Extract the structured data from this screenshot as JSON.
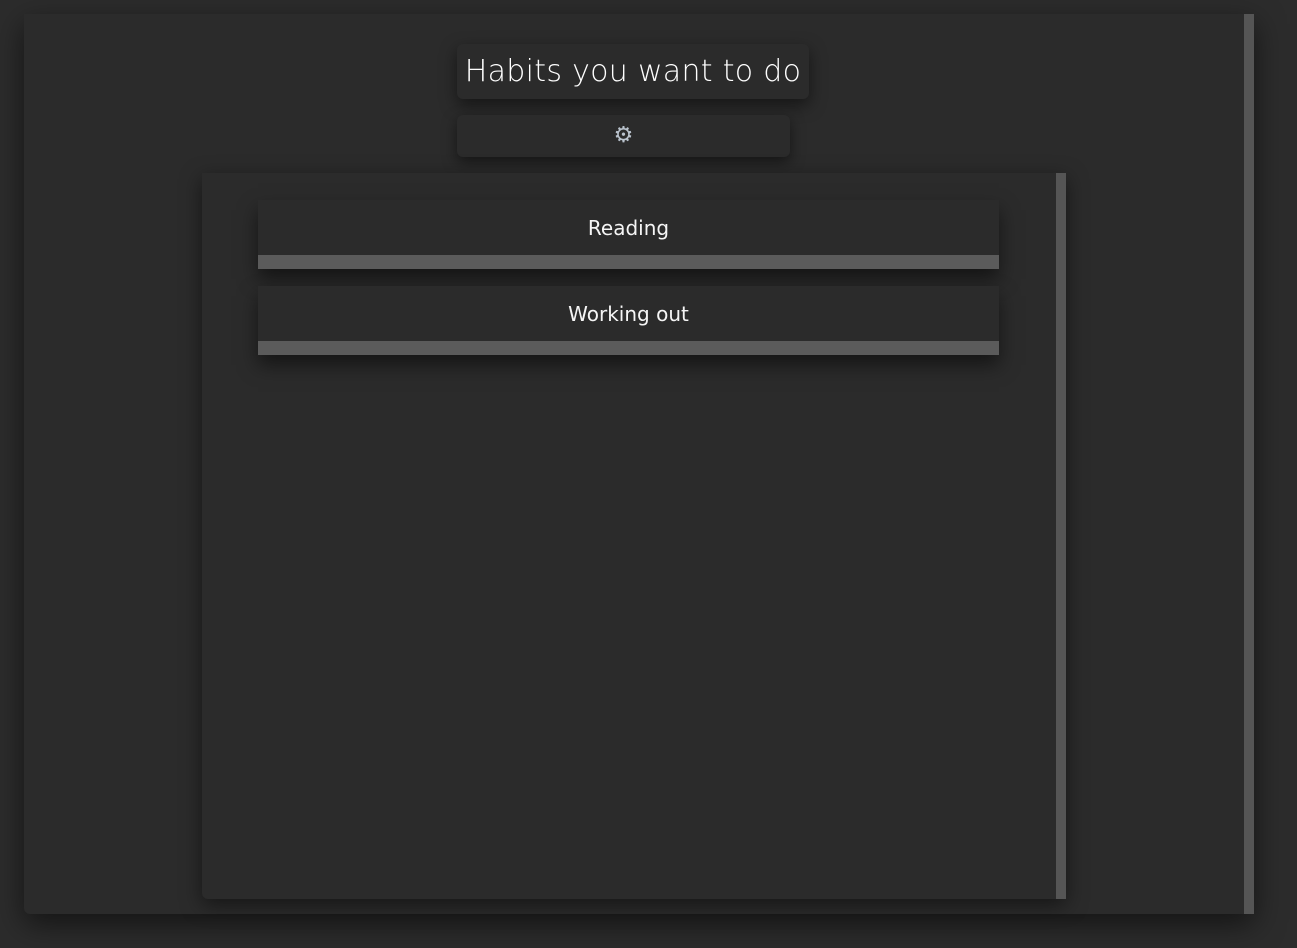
{
  "header": {
    "title": "Habits you want to do",
    "settings_icon": "gear-icon"
  },
  "habits": [
    {
      "label": "Reading",
      "progress": 0
    },
    {
      "label": "Working out",
      "progress": 0
    }
  ],
  "colors": {
    "background": "#2c2c2c",
    "panel": "#2b2b2b",
    "scrollbar": "#555555",
    "progress_track": "#5b5b5b"
  }
}
